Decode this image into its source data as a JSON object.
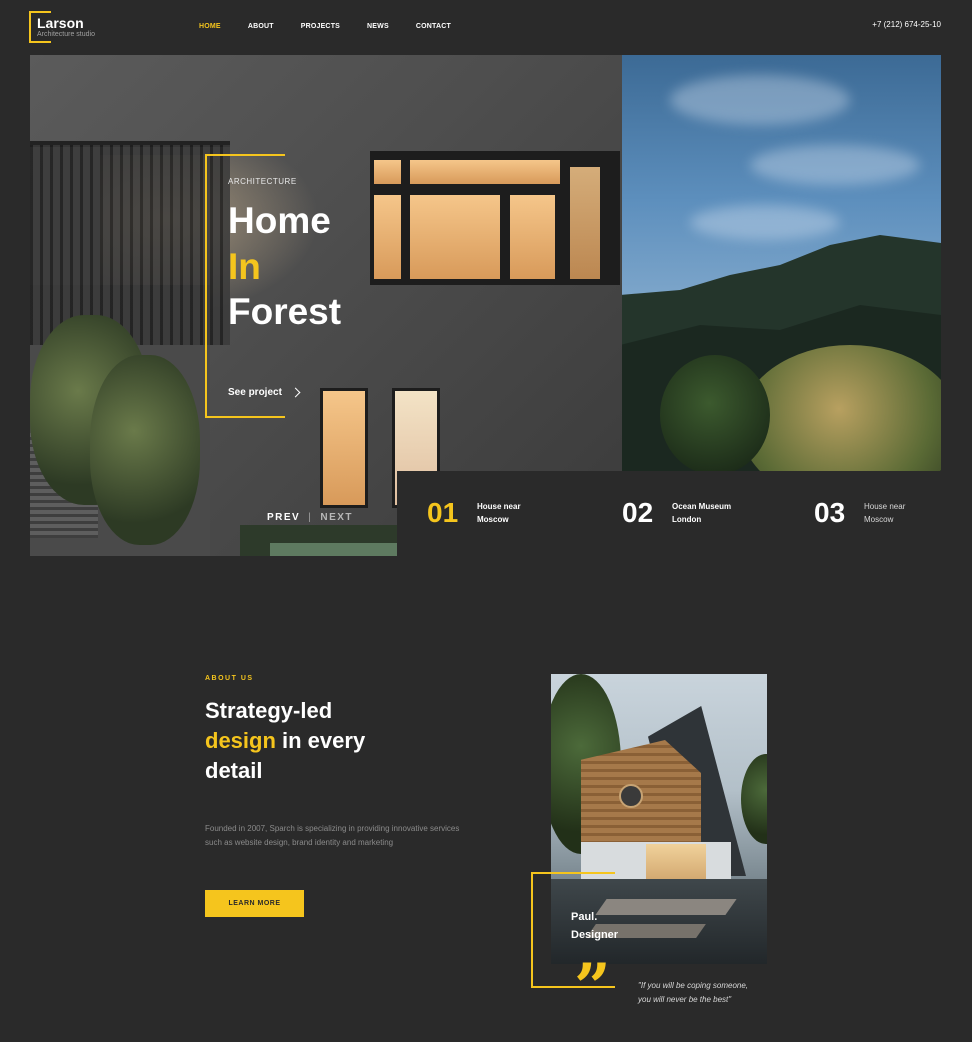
{
  "brand": {
    "name": "Larson",
    "tagline": "Architecture studio"
  },
  "nav": {
    "items": [
      "HOME",
      "ABOUT",
      "PROJECTS",
      "NEWS",
      "CONTACT"
    ],
    "active": "HOME"
  },
  "phone": "+7 (212) 674-25-10",
  "hero": {
    "category": "ARCHITECTURE",
    "title_line1": "Home",
    "title_line2": "In",
    "title_line3": "Forest",
    "cta": "See project",
    "prev": "PREV",
    "separator": "|",
    "next": "NEXT"
  },
  "slides": [
    {
      "num": "01",
      "line1": "House near",
      "line2": "Moscow",
      "active": true
    },
    {
      "num": "02",
      "line1": "Ocean Museum",
      "line2": "London",
      "active": false
    },
    {
      "num": "03",
      "line1": "House near",
      "line2": "Moscow",
      "active": false
    }
  ],
  "about": {
    "label": "ABOUT US",
    "title_line1": "Strategy-led",
    "title_highlight": "design",
    "title_line2_rest": " in every",
    "title_line3": "detail",
    "text": "Founded in 2007, Sparch is specializing in providing innovative services such as website design, brand  identity and marketing",
    "button": "LEARN MORE"
  },
  "quote": {
    "name_line1": "Paul.",
    "name_line2": "Designer",
    "mark": "”",
    "text_line1": "\"If you will be coping someone,",
    "text_line2": "you will never be the best\""
  },
  "colors": {
    "accent": "#f5c51d",
    "background": "#2a2a2a",
    "text": "#ffffff"
  }
}
